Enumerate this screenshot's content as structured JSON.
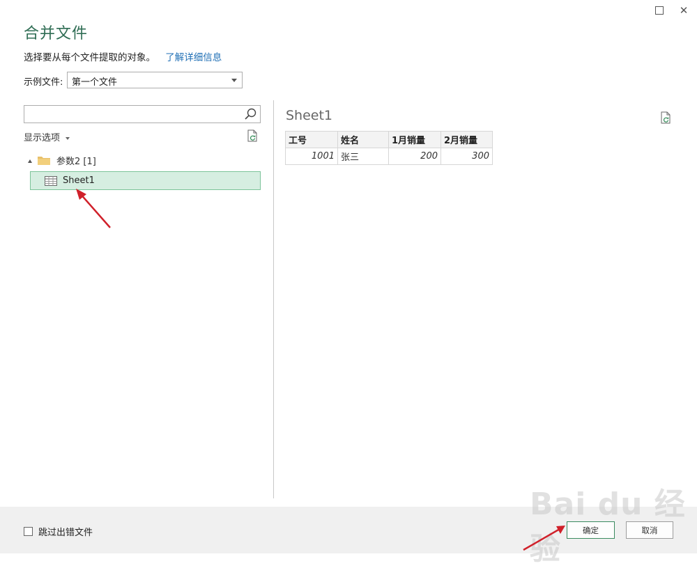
{
  "window": {
    "maximize_icon": "maximize-icon",
    "close_icon": "close-icon",
    "close_glyph": "✕"
  },
  "header": {
    "title": "合并文件",
    "subtitle": "选择要从每个文件提取的对象。",
    "learn_more": "了解详细信息"
  },
  "example_file": {
    "label": "示例文件:",
    "selected": "第一个文件"
  },
  "navigator": {
    "search_placeholder": "",
    "display_options": "显示选项",
    "tree": {
      "folder_label": "参数2 [1]",
      "sheet_label": "Sheet1"
    }
  },
  "preview": {
    "title": "Sheet1",
    "columns": [
      "工号",
      "姓名",
      "1月销量",
      "2月销量"
    ],
    "rows": [
      [
        "1001",
        "张三",
        "200",
        "300"
      ]
    ]
  },
  "footer": {
    "skip_errors_label": "跳过出错文件",
    "skip_errors_checked": false,
    "ok_label": "确定",
    "cancel_label": "取消"
  },
  "watermark": {
    "text": "Bai du 经验"
  },
  "colors": {
    "accent": "#2f6d54",
    "selection_bg": "#d6eee1",
    "selection_border": "#7cc399",
    "link": "#1f6fb5",
    "annotation_arrow": "#d0202a"
  }
}
